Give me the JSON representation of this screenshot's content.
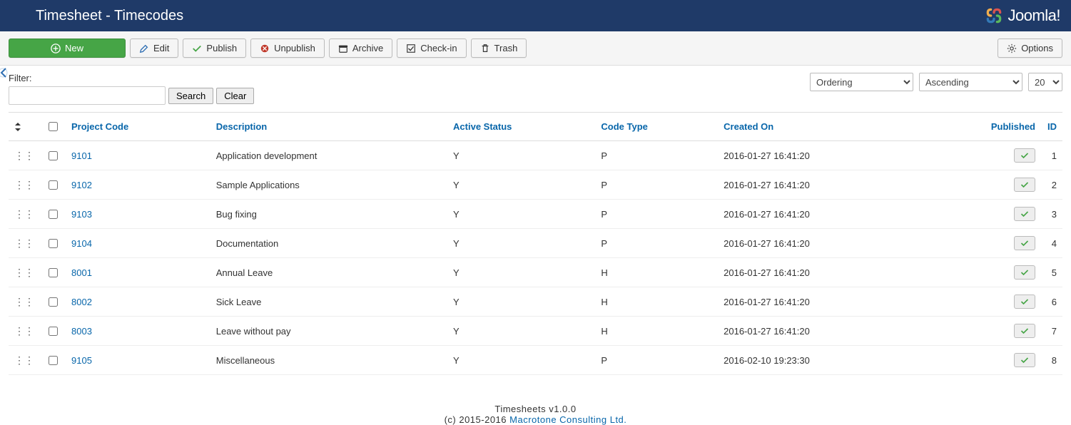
{
  "header": {
    "title": "Timesheet - Timecodes",
    "brand": "Joomla!"
  },
  "toolbar": {
    "new_label": "New",
    "edit_label": "Edit",
    "publish_label": "Publish",
    "unpublish_label": "Unpublish",
    "archive_label": "Archive",
    "checkin_label": "Check-in",
    "trash_label": "Trash",
    "options_label": "Options"
  },
  "filter": {
    "label": "Filter:",
    "value": "",
    "search_label": "Search",
    "clear_label": "Clear",
    "sort_field": "Ordering",
    "sort_dir": "Ascending",
    "limit": "20"
  },
  "columns": {
    "project_code": "Project Code",
    "description": "Description",
    "active_status": "Active Status",
    "code_type": "Code Type",
    "created_on": "Created On",
    "published": "Published",
    "id": "ID"
  },
  "rows": [
    {
      "code": "9101",
      "desc": "Application development",
      "active": "Y",
      "type": "P",
      "created": "2016-01-27 16:41:20",
      "id": "1"
    },
    {
      "code": "9102",
      "desc": "Sample Applications",
      "active": "Y",
      "type": "P",
      "created": "2016-01-27 16:41:20",
      "id": "2"
    },
    {
      "code": "9103",
      "desc": "Bug fixing",
      "active": "Y",
      "type": "P",
      "created": "2016-01-27 16:41:20",
      "id": "3"
    },
    {
      "code": "9104",
      "desc": "Documentation",
      "active": "Y",
      "type": "P",
      "created": "2016-01-27 16:41:20",
      "id": "4"
    },
    {
      "code": "8001",
      "desc": "Annual Leave",
      "active": "Y",
      "type": "H",
      "created": "2016-01-27 16:41:20",
      "id": "5"
    },
    {
      "code": "8002",
      "desc": "Sick Leave",
      "active": "Y",
      "type": "H",
      "created": "2016-01-27 16:41:20",
      "id": "6"
    },
    {
      "code": "8003",
      "desc": "Leave without pay",
      "active": "Y",
      "type": "H",
      "created": "2016-01-27 16:41:20",
      "id": "7"
    },
    {
      "code": "9105",
      "desc": "Miscellaneous",
      "active": "Y",
      "type": "P",
      "created": "2016-02-10 19:23:30",
      "id": "8"
    }
  ],
  "footer": {
    "line1": "Timesheets v1.0.0",
    "prefix": "(c) 2015-2016 ",
    "link": "Macrotone Consulting Ltd."
  }
}
